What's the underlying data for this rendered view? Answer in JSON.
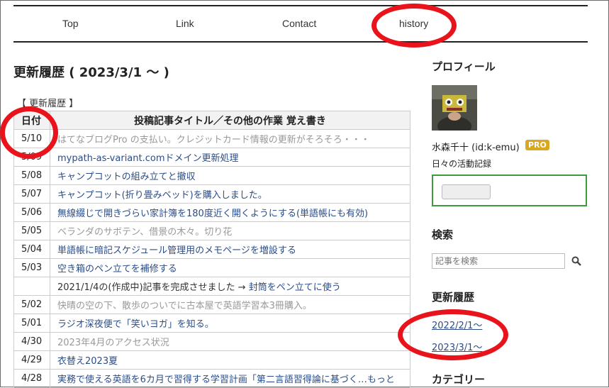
{
  "nav": {
    "items": [
      "Top",
      "Link",
      "Contact",
      "history"
    ]
  },
  "main": {
    "title": "更新履歴 ( 2023/3/1 ～ )",
    "section_label": "【 更新履歴 】",
    "table": {
      "headers": [
        "日付",
        "投稿記事タイトル／その他の作業 覚え書き"
      ],
      "rows": [
        {
          "date": "5/10",
          "text": "はてなブログPro の支払い。クレジットカード情報の更新がそろそろ・・・",
          "style": "gray"
        },
        {
          "date": "5/09",
          "text": "mypath-as-variant.comドメイン更新処理",
          "style": "link"
        },
        {
          "date": "5/08",
          "text": "キャンプコットの組み立てと撤収",
          "style": "link"
        },
        {
          "date": "5/07",
          "text": "キャンプコット(折り畳みベッド)を購入しました。",
          "style": "link"
        },
        {
          "date": "5/06",
          "text": "無線綴じで開きづらい家計簿を180度近く開くようにする(単語帳にも有効)",
          "style": "link"
        },
        {
          "date": "5/05",
          "text": "ベランダのサボテン、借景の木々。切り花",
          "style": "gray"
        },
        {
          "date": "5/04",
          "text": "単語帳に暗記スケジュール管理用のメモページを増設する",
          "style": "link"
        },
        {
          "date": "5/03",
          "text": "空き箱のペン立てを補修する",
          "style": "link"
        },
        {
          "date": "",
          "text_prefix": "2021/1/4の(作成中)記事を完成させました → ",
          "text_link": "封筒をペン立てに使う",
          "style": "mixed"
        },
        {
          "date": "5/02",
          "text": "快晴の空の下、散歩のついでに古本屋で英語学習本3冊購入。",
          "style": "gray"
        },
        {
          "date": "5/01",
          "text": "ラジオ深夜便で「笑いヨガ」を知る。",
          "style": "link"
        },
        {
          "date": "4/30",
          "text": "2023年4月のアクセス状況",
          "style": "gray"
        },
        {
          "date": "4/29",
          "text": "衣替え2023夏",
          "style": "link"
        },
        {
          "date": "4/28",
          "text": "実務で使える英語を6カ月で習得する学習計画「第二言語習得論に基づく…もっと",
          "style": "link"
        }
      ]
    }
  },
  "sidebar": {
    "profile_heading": "プロフィール",
    "profile_name": "水森千十 (id:k-emu)",
    "pro_badge": "PRO",
    "profile_desc": "日々の活動記録",
    "search_heading": "検索",
    "search_placeholder": "記事を検索",
    "history_heading": "更新履歴",
    "history_links": [
      "2022/2/1～",
      "2023/3/1～"
    ],
    "category_heading": "カテゴリー"
  },
  "colors": {
    "annotation_red": "#e8131b",
    "link": "#2a4d8a",
    "pro_badge": "#d9a81e",
    "box_green": "#3c9b3c"
  }
}
